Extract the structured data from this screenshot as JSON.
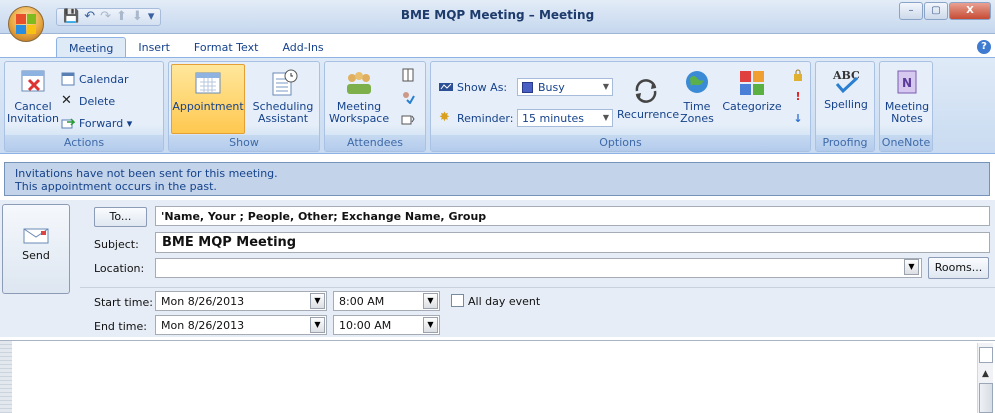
{
  "window": {
    "title": "BME MQP Meeting – Meeting",
    "minimize": "–",
    "maximize": "▢",
    "close": "X"
  },
  "quick_access": [
    "💾",
    "↶",
    "↷",
    "⬆",
    "⬇",
    "▾"
  ],
  "tabs": [
    "Meeting",
    "Insert",
    "Format Text",
    "Add-Ins"
  ],
  "help": "?",
  "ribbon": {
    "actions": {
      "label": "Actions",
      "cancel": "Cancel\nInvitation",
      "calendar": "Calendar",
      "delete": "Delete",
      "forward": "Forward ▾"
    },
    "show": {
      "label": "Show",
      "appointment": "Appointment",
      "scheduling": "Scheduling\nAssistant"
    },
    "attendees": {
      "label": "Attendees",
      "workspace": "Meeting\nWorkspace"
    },
    "options": {
      "label": "Options",
      "show_as_label": "Show As:",
      "show_as_value": "Busy",
      "reminder_label": "Reminder:",
      "reminder_value": "15 minutes",
      "recurrence": "Recurrence",
      "time_zones": "Time\nZones",
      "categorize": "Categorize"
    },
    "proofing": {
      "label": "Proofing",
      "spelling": "Spelling"
    },
    "onenote": {
      "label": "OneNote",
      "notes": "Meeting\nNotes"
    }
  },
  "infobar": {
    "line1": "Invitations have not been sent for this meeting.",
    "line2": "This appointment occurs in the past."
  },
  "form": {
    "send": "Send",
    "to_button": "To...",
    "to_value": "'Name, Your ; People, Other; Exchange Name, Group",
    "subject_label": "Subject:",
    "subject_value": "BME MQP Meeting",
    "location_label": "Location:",
    "location_value": "",
    "rooms_button": "Rooms...",
    "start_label": "Start time:",
    "start_date": "Mon 8/26/2013",
    "start_time": "8:00 AM",
    "end_label": "End time:",
    "end_date": "Mon 8/26/2013",
    "end_time": "10:00 AM",
    "all_day": "All day event"
  },
  "colors": {
    "accent": "#15428b",
    "ribbon_bg": "#dfeaf7",
    "infobar": "#c3d4ea"
  }
}
